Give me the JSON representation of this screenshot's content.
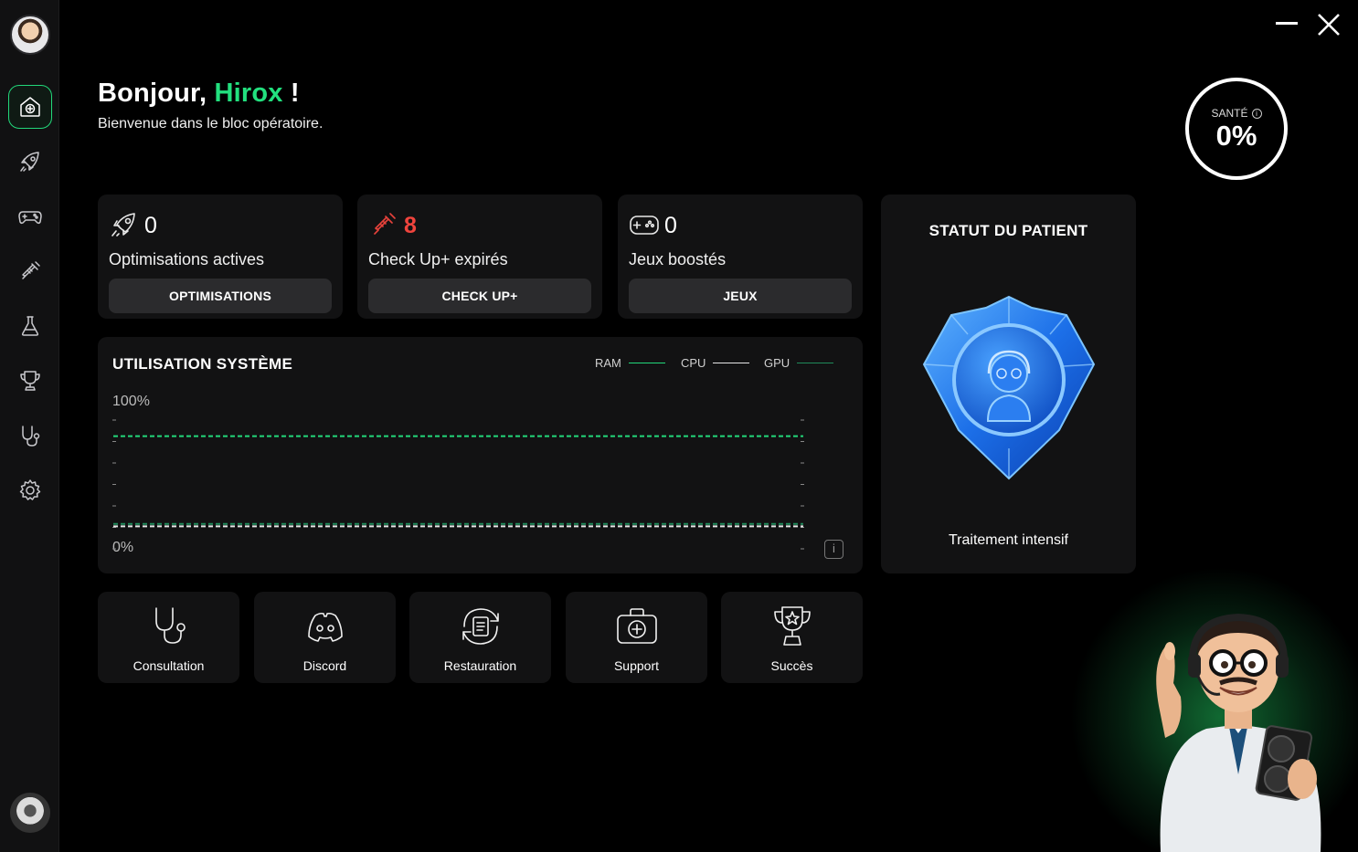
{
  "greeting": {
    "prefix": "Bonjour, ",
    "name": "Hirox",
    "suffix": " !",
    "subtitle": "Bienvenue dans le bloc opératoire."
  },
  "health": {
    "label": "SANTÉ",
    "value": "0%",
    "info_icon": "info-icon"
  },
  "window": {
    "minimize_icon": "minimize-icon",
    "close_icon": "close-icon"
  },
  "sidebar": {
    "items": [
      {
        "id": "home",
        "icon": "home-plus-icon",
        "active": true
      },
      {
        "id": "rocket",
        "icon": "rocket-icon"
      },
      {
        "id": "games",
        "icon": "gamepad-icon"
      },
      {
        "id": "syringe",
        "icon": "syringe-icon"
      },
      {
        "id": "lab",
        "icon": "flask-icon"
      },
      {
        "id": "trophy",
        "icon": "trophy-icon"
      },
      {
        "id": "stethoscope",
        "icon": "stethoscope-icon"
      },
      {
        "id": "settings",
        "icon": "gear-icon"
      }
    ]
  },
  "stats": [
    {
      "icon": "rocket-icon",
      "value": "0",
      "label": "Optimisations actives",
      "button": "OPTIMISATIONS"
    },
    {
      "icon": "syringe-icon",
      "value": "8",
      "label": "Check Up+ expirés",
      "button": "CHECK UP+"
    },
    {
      "icon": "gamepad-icon",
      "value": "0",
      "label": "Jeux boostés",
      "button": "JEUX"
    }
  ],
  "usage": {
    "title": "UTILISATION SYSTÈME",
    "y_max_label": "100%",
    "y_min_label": "0%",
    "info": "i"
  },
  "chart_data": {
    "type": "line",
    "title": "UTILISATION SYSTÈME",
    "ylim": [
      0,
      100
    ],
    "series": [
      {
        "name": "RAM",
        "color": "#22d87a",
        "values": [
          78,
          78
        ]
      },
      {
        "name": "CPU",
        "color": "#e6e6e6",
        "values": [
          2,
          2
        ]
      },
      {
        "name": "GPU",
        "color": "#1f8a5a",
        "values": [
          4,
          4
        ]
      }
    ]
  },
  "patient": {
    "title": "STATUT DU PATIENT",
    "status": "Traitement intensif"
  },
  "quick_actions": [
    {
      "icon": "stethoscope-icon",
      "label": "Consultation"
    },
    {
      "icon": "discord-icon",
      "label": "Discord"
    },
    {
      "icon": "restore-icon",
      "label": "Restauration"
    },
    {
      "icon": "medkit-icon",
      "label": "Support"
    },
    {
      "icon": "trophy-icon",
      "label": "Succès"
    }
  ],
  "colors": {
    "accent": "#22e07e",
    "danger": "#f0443d",
    "card": "#121213",
    "button": "#2b2b2d"
  }
}
